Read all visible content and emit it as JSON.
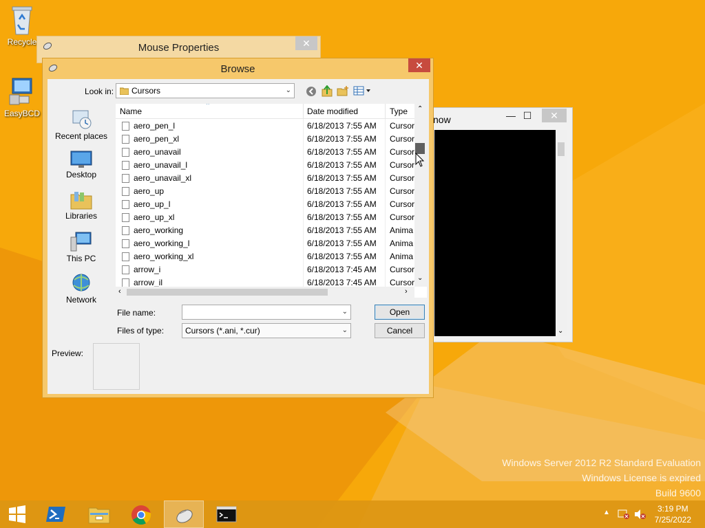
{
  "desktop": {
    "icons": [
      {
        "label": "Recycle",
        "icon": "recycle-bin-icon"
      },
      {
        "label": "EasyBCD",
        "icon": "easybcd-icon"
      }
    ],
    "watermark": {
      "line1": "Windows Server 2012 R2 Standard Evaluation",
      "line2": "Windows License is expired",
      "line3": "Build 9600"
    }
  },
  "mouse_properties": {
    "title": "Mouse Properties",
    "close": "✕"
  },
  "terminal": {
    "title_fragment": "now",
    "minimize": "—",
    "maximize": "☐",
    "close": "✕"
  },
  "browse": {
    "title": "Browse",
    "close": "✕",
    "look_in_label": "Look in:",
    "look_in_value": "Cursors",
    "places": [
      {
        "label": "Recent places",
        "icon": "recent-places-icon"
      },
      {
        "label": "Desktop",
        "icon": "desktop-icon"
      },
      {
        "label": "Libraries",
        "icon": "libraries-icon"
      },
      {
        "label": "This PC",
        "icon": "this-pc-icon"
      },
      {
        "label": "Network",
        "icon": "network-icon"
      }
    ],
    "columns": {
      "name": "Name",
      "date": "Date modified",
      "type": "Type"
    },
    "files": [
      {
        "name": "aero_pen_l",
        "date": "6/18/2013 7:55 AM",
        "type": "Cursor"
      },
      {
        "name": "aero_pen_xl",
        "date": "6/18/2013 7:55 AM",
        "type": "Cursor"
      },
      {
        "name": "aero_unavail",
        "date": "6/18/2013 7:55 AM",
        "type": "Cursor"
      },
      {
        "name": "aero_unavail_l",
        "date": "6/18/2013 7:55 AM",
        "type": "Cursor"
      },
      {
        "name": "aero_unavail_xl",
        "date": "6/18/2013 7:55 AM",
        "type": "Cursor"
      },
      {
        "name": "aero_up",
        "date": "6/18/2013 7:55 AM",
        "type": "Cursor"
      },
      {
        "name": "aero_up_l",
        "date": "6/18/2013 7:55 AM",
        "type": "Cursor"
      },
      {
        "name": "aero_up_xl",
        "date": "6/18/2013 7:55 AM",
        "type": "Cursor"
      },
      {
        "name": "aero_working",
        "date": "6/18/2013 7:55 AM",
        "type": "Anima"
      },
      {
        "name": "aero_working_l",
        "date": "6/18/2013 7:55 AM",
        "type": "Anima"
      },
      {
        "name": "aero_working_xl",
        "date": "6/18/2013 7:55 AM",
        "type": "Anima"
      },
      {
        "name": "arrow_i",
        "date": "6/18/2013 7:45 AM",
        "type": "Cursor"
      },
      {
        "name": "arrow_il",
        "date": "6/18/2013 7:45 AM",
        "type": "Cursor"
      }
    ],
    "file_name_label": "File name:",
    "file_name_value": "",
    "files_of_type_label": "Files of type:",
    "files_of_type_value": "Cursors (*.ani, *.cur)",
    "open_label": "Open",
    "cancel_label": "Cancel",
    "preview_label": "Preview:"
  },
  "taskbar": {
    "items": [
      {
        "icon": "start-icon"
      },
      {
        "icon": "powershell-icon"
      },
      {
        "icon": "file-explorer-icon"
      },
      {
        "icon": "chrome-icon"
      },
      {
        "icon": "mouse-icon"
      },
      {
        "icon": "cmd-icon"
      }
    ],
    "time": "3:19 PM",
    "date": "7/25/2022"
  },
  "colors": {
    "desktop_orange": "#f7a80a",
    "dialog_frame": "#f6c86b",
    "close_red": "#c74b3e"
  }
}
